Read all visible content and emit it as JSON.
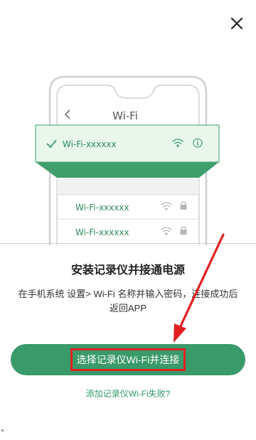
{
  "close_icon": "close-icon",
  "illustration": {
    "phone_title": "Wi-Fi",
    "highlighted_network": "Wi-Fi-xxxxxx",
    "networks": [
      "Wi-Fi-xxxxxx",
      "Wi-Fi-xxxxxx"
    ],
    "icons": [
      "back-chevron-icon",
      "check-icon",
      "wifi-icon",
      "info-icon",
      "lock-icon"
    ]
  },
  "title": "安装记录仪并接通电源",
  "description": "在手机系统 设置> Wi-Fi 名称并输入密码，连接成功后返回APP",
  "primary_button": "选择记录仪Wi-Fi并连接",
  "fail_link": "添加记录仪Wi-Fi失败?",
  "colors": {
    "accent": "#3a9a69",
    "highlight_fill": "#e6f5ea",
    "annotation": "#e02020"
  }
}
